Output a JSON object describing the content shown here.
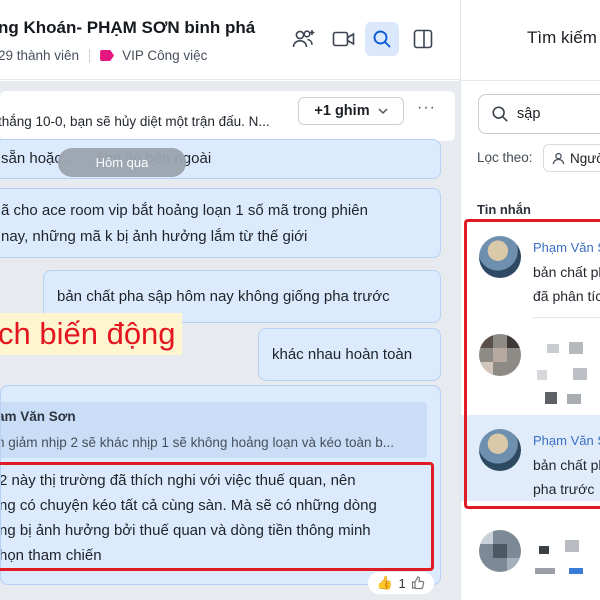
{
  "header": {
    "title": "ng Khoán- PHẠM SƠN binh phá",
    "members": "29 thành viên",
    "tag_label": "VIP Công việc"
  },
  "pin": {
    "text": "thắng 10-0, bạn sẽ hủy diệt một trận đấu. N...",
    "button_label": "+1 ghim",
    "more": "···"
  },
  "messages": {
    "date_separator": "Hôm qua",
    "m1_line": "sẵn hoặc… …ông tin bên ngoài",
    "m2_line1": "ã cho ace room vip bắt hoảng loạn 1 số mã trong phiên",
    "m2_line2": " nay, những mã k bị ảnh hưởng lắm từ thế giới",
    "m3": "bản chất pha sập hôm nay không giống pha trước",
    "overlay": "ch biến động",
    "m4": "khác nhau hoàn toàn",
    "reply": {
      "quote_author": "am Văn Sơn",
      "quote_text": "n giảm nhịp 2 sẽ khác nhịp 1 sẽ không hoảng loạn và kéo toàn b...",
      "line1": " 2 này thị trường đã thích nghi với việc thuế quan, nên",
      "line2": "ng có chuyện kéo tất cả cùng sàn. Mà sẽ có những dòng",
      "line3": "ng bị ảnh hưởng bởi thuế quan và dòng tiền thông minh",
      "line4": "họn tham chiến"
    },
    "reaction_count": "1"
  },
  "search_panel": {
    "title": "Tìm kiếm",
    "query": "sập",
    "filter_label": "Lọc theo:",
    "filter_chip": "Người gửi",
    "section_label": "Tin nhắn",
    "results": [
      {
        "name": "Phạm Văn Sơn",
        "line1": "bản chất pha sập",
        "line2": "đã phân tích"
      },
      {
        "name": "",
        "line1": "",
        "line2": ""
      },
      {
        "name": "Phạm Văn Sơn",
        "line1": "bản chất pha sập",
        "line2": "pha trước"
      }
    ]
  },
  "colors": {
    "accent": "#0068ff",
    "bubble": "#dbeafd",
    "highlight_box": "#e01b24",
    "tag": "#e6157f"
  },
  "icons": [
    "add-member-icon",
    "video-call-icon",
    "search-icon",
    "sidebar-toggle-icon",
    "chevron-down-icon",
    "user-icon",
    "thumbs-up-icon"
  ]
}
